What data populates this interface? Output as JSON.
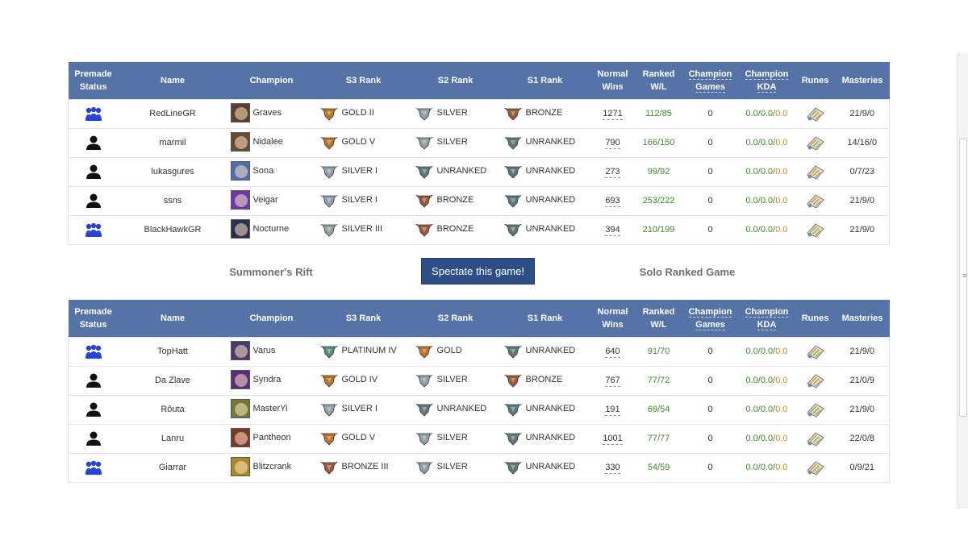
{
  "headers": {
    "premade_status": "Premade Status",
    "name": "Name",
    "champion": "Champion",
    "s3_rank": "S3 Rank",
    "s2_rank": "S2 Rank",
    "s1_rank": "S1 Rank",
    "normal_wins": "Normal Wins",
    "ranked_wl": "Ranked W/L",
    "champion_games": "Champion Games",
    "champion_kda": "Champion KDA",
    "runes": "Runes",
    "masteries": "Masteries"
  },
  "game": {
    "map": "Summoner's Rift",
    "spectate_label": "Spectate this game!",
    "queue": "Solo Ranked Game"
  },
  "colors": {
    "header_bg": "#5673a8",
    "spectate_bg": "#2f4d86",
    "premade_icon": "#2643d6",
    "solo_icon": "#111111",
    "wl_text": "#3e8c2e",
    "kda_green": "#3e8c2e",
    "kda_orange": "#e08424",
    "gold_emblem": "#b8742f",
    "silver_emblem": "#8ea0a8",
    "bronze_emblem": "#9a5b3a",
    "platinum_emblem": "#5b8a7e",
    "unranked_emblem": "#5e777e"
  },
  "teams": [
    {
      "players": [
        {
          "premade": "premade-group-icon",
          "name": "RedLineGR",
          "champion": "Graves",
          "portrait_color": "#5a4030",
          "s3": {
            "label": "GOLD II",
            "tier": "gold"
          },
          "s2": {
            "label": "SILVER",
            "tier": "silver"
          },
          "s1": {
            "label": "BRONZE",
            "tier": "bronze"
          },
          "normal_wins": "1271",
          "ranked_wl": "112/85",
          "champ_games": "0",
          "kda_a": "0.0/0.0/",
          "kda_b": "0.0",
          "masteries": "21/9/0"
        },
        {
          "premade": "solo-player-icon",
          "name": "marmil",
          "champion": "Nidalee",
          "portrait_color": "#6b4a33",
          "s3": {
            "label": "GOLD V",
            "tier": "gold"
          },
          "s2": {
            "label": "SILVER",
            "tier": "silver"
          },
          "s1": {
            "label": "UNRANKED",
            "tier": "unranked"
          },
          "normal_wins": "790",
          "ranked_wl": "166/150",
          "champ_games": "0",
          "kda_a": "0.0/0.0/",
          "kda_b": "0.0",
          "masteries": "14/16/0"
        },
        {
          "premade": "solo-player-icon",
          "name": "lukasgures",
          "champion": "Sona",
          "portrait_color": "#4e6fb0",
          "s3": {
            "label": "SILVER I",
            "tier": "silver"
          },
          "s2": {
            "label": "UNRANKED",
            "tier": "unranked"
          },
          "s1": {
            "label": "UNRANKED",
            "tier": "unranked"
          },
          "normal_wins": "273",
          "ranked_wl": "99/92",
          "champ_games": "0",
          "kda_a": "0.0/0.0/",
          "kda_b": "0.0",
          "masteries": "0/7/23"
        },
        {
          "premade": "solo-player-icon",
          "name": "ssns",
          "champion": "Veigar",
          "portrait_color": "#6a3aa8",
          "s3": {
            "label": "SILVER I",
            "tier": "silver"
          },
          "s2": {
            "label": "BRONZE",
            "tier": "bronze"
          },
          "s1": {
            "label": "UNRANKED",
            "tier": "unranked"
          },
          "normal_wins": "693",
          "ranked_wl": "253/222",
          "champ_games": "0",
          "kda_a": "0.0/0.0/",
          "kda_b": "0.0",
          "masteries": "21/9/0"
        },
        {
          "premade": "premade-group-icon",
          "name": "BlackHawkGR",
          "champion": "Nocturne",
          "portrait_color": "#2a2f55",
          "s3": {
            "label": "SILVER III",
            "tier": "silver"
          },
          "s2": {
            "label": "BRONZE",
            "tier": "bronze"
          },
          "s1": {
            "label": "UNRANKED",
            "tier": "unranked"
          },
          "normal_wins": "394",
          "ranked_wl": "210/199",
          "champ_games": "0",
          "kda_a": "0.0/0.0/",
          "kda_b": "0.0",
          "masteries": "21/9/0"
        }
      ]
    },
    {
      "players": [
        {
          "premade": "premade-group-icon",
          "name": "TopHatt",
          "champion": "Varus",
          "portrait_color": "#4a3a6e",
          "s3": {
            "label": "PLATINUM IV",
            "tier": "platinum"
          },
          "s2": {
            "label": "GOLD",
            "tier": "gold"
          },
          "s1": {
            "label": "UNRANKED",
            "tier": "unranked"
          },
          "normal_wins": "640",
          "ranked_wl": "91/70",
          "champ_games": "0",
          "kda_a": "0.0/0.0/",
          "kda_b": "0.0",
          "masteries": "21/9/0"
        },
        {
          "premade": "solo-player-icon",
          "name": "Da Zlave",
          "champion": "Syndra",
          "portrait_color": "#5a2f78",
          "s3": {
            "label": "GOLD IV",
            "tier": "gold"
          },
          "s2": {
            "label": "SILVER",
            "tier": "silver"
          },
          "s1": {
            "label": "BRONZE",
            "tier": "bronze"
          },
          "normal_wins": "767",
          "ranked_wl": "77/72",
          "champ_games": "0",
          "kda_a": "0.0/0.0/",
          "kda_b": "0.0",
          "masteries": "21/0/9"
        },
        {
          "premade": "solo-player-icon",
          "name": "Rôuta",
          "champion": "MasterYi",
          "portrait_color": "#6f7a3a",
          "s3": {
            "label": "SILVER I",
            "tier": "silver"
          },
          "s2": {
            "label": "UNRANKED",
            "tier": "unranked"
          },
          "s1": {
            "label": "UNRANKED",
            "tier": "unranked"
          },
          "normal_wins": "191",
          "ranked_wl": "69/54",
          "champ_games": "0",
          "kda_a": "0.0/0.0/",
          "kda_b": "0.0",
          "masteries": "21/9/0"
        },
        {
          "premade": "solo-player-icon",
          "name": "Lanru",
          "champion": "Pantheon",
          "portrait_color": "#7a3a2a",
          "s3": {
            "label": "GOLD V",
            "tier": "gold"
          },
          "s2": {
            "label": "SILVER",
            "tier": "silver"
          },
          "s1": {
            "label": "UNRANKED",
            "tier": "unranked"
          },
          "normal_wins": "1001",
          "ranked_wl": "77/77",
          "champ_games": "0",
          "kda_a": "0.0/0.0/",
          "kda_b": "0.0",
          "masteries": "22/0/8"
        },
        {
          "premade": "premade-group-icon",
          "name": "Giarrar",
          "champion": "Blitzcrank",
          "portrait_color": "#a88a2a",
          "s3": {
            "label": "BRONZE III",
            "tier": "bronze"
          },
          "s2": {
            "label": "SILVER",
            "tier": "silver"
          },
          "s1": {
            "label": "UNRANKED",
            "tier": "unranked"
          },
          "normal_wins": "330",
          "ranked_wl": "54/59",
          "champ_games": "0",
          "kda_a": "0.0/0.0/",
          "kda_b": "0.0",
          "masteries": "0/9/21"
        }
      ]
    }
  ]
}
